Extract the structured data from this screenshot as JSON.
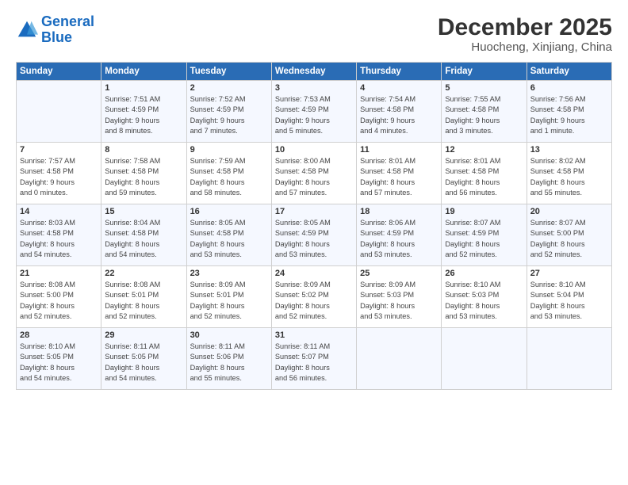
{
  "logo": {
    "line1": "General",
    "line2": "Blue"
  },
  "title": "December 2025",
  "location": "Huocheng, Xinjiang, China",
  "headers": [
    "Sunday",
    "Monday",
    "Tuesday",
    "Wednesday",
    "Thursday",
    "Friday",
    "Saturday"
  ],
  "weeks": [
    [
      {
        "day": "",
        "info": ""
      },
      {
        "day": "1",
        "info": "Sunrise: 7:51 AM\nSunset: 4:59 PM\nDaylight: 9 hours\nand 8 minutes."
      },
      {
        "day": "2",
        "info": "Sunrise: 7:52 AM\nSunset: 4:59 PM\nDaylight: 9 hours\nand 7 minutes."
      },
      {
        "day": "3",
        "info": "Sunrise: 7:53 AM\nSunset: 4:59 PM\nDaylight: 9 hours\nand 5 minutes."
      },
      {
        "day": "4",
        "info": "Sunrise: 7:54 AM\nSunset: 4:58 PM\nDaylight: 9 hours\nand 4 minutes."
      },
      {
        "day": "5",
        "info": "Sunrise: 7:55 AM\nSunset: 4:58 PM\nDaylight: 9 hours\nand 3 minutes."
      },
      {
        "day": "6",
        "info": "Sunrise: 7:56 AM\nSunset: 4:58 PM\nDaylight: 9 hours\nand 1 minute."
      }
    ],
    [
      {
        "day": "7",
        "info": "Sunrise: 7:57 AM\nSunset: 4:58 PM\nDaylight: 9 hours\nand 0 minutes."
      },
      {
        "day": "8",
        "info": "Sunrise: 7:58 AM\nSunset: 4:58 PM\nDaylight: 8 hours\nand 59 minutes."
      },
      {
        "day": "9",
        "info": "Sunrise: 7:59 AM\nSunset: 4:58 PM\nDaylight: 8 hours\nand 58 minutes."
      },
      {
        "day": "10",
        "info": "Sunrise: 8:00 AM\nSunset: 4:58 PM\nDaylight: 8 hours\nand 57 minutes."
      },
      {
        "day": "11",
        "info": "Sunrise: 8:01 AM\nSunset: 4:58 PM\nDaylight: 8 hours\nand 57 minutes."
      },
      {
        "day": "12",
        "info": "Sunrise: 8:01 AM\nSunset: 4:58 PM\nDaylight: 8 hours\nand 56 minutes."
      },
      {
        "day": "13",
        "info": "Sunrise: 8:02 AM\nSunset: 4:58 PM\nDaylight: 8 hours\nand 55 minutes."
      }
    ],
    [
      {
        "day": "14",
        "info": "Sunrise: 8:03 AM\nSunset: 4:58 PM\nDaylight: 8 hours\nand 54 minutes."
      },
      {
        "day": "15",
        "info": "Sunrise: 8:04 AM\nSunset: 4:58 PM\nDaylight: 8 hours\nand 54 minutes."
      },
      {
        "day": "16",
        "info": "Sunrise: 8:05 AM\nSunset: 4:58 PM\nDaylight: 8 hours\nand 53 minutes."
      },
      {
        "day": "17",
        "info": "Sunrise: 8:05 AM\nSunset: 4:59 PM\nDaylight: 8 hours\nand 53 minutes."
      },
      {
        "day": "18",
        "info": "Sunrise: 8:06 AM\nSunset: 4:59 PM\nDaylight: 8 hours\nand 53 minutes."
      },
      {
        "day": "19",
        "info": "Sunrise: 8:07 AM\nSunset: 4:59 PM\nDaylight: 8 hours\nand 52 minutes."
      },
      {
        "day": "20",
        "info": "Sunrise: 8:07 AM\nSunset: 5:00 PM\nDaylight: 8 hours\nand 52 minutes."
      }
    ],
    [
      {
        "day": "21",
        "info": "Sunrise: 8:08 AM\nSunset: 5:00 PM\nDaylight: 8 hours\nand 52 minutes."
      },
      {
        "day": "22",
        "info": "Sunrise: 8:08 AM\nSunset: 5:01 PM\nDaylight: 8 hours\nand 52 minutes."
      },
      {
        "day": "23",
        "info": "Sunrise: 8:09 AM\nSunset: 5:01 PM\nDaylight: 8 hours\nand 52 minutes."
      },
      {
        "day": "24",
        "info": "Sunrise: 8:09 AM\nSunset: 5:02 PM\nDaylight: 8 hours\nand 52 minutes."
      },
      {
        "day": "25",
        "info": "Sunrise: 8:09 AM\nSunset: 5:03 PM\nDaylight: 8 hours\nand 53 minutes."
      },
      {
        "day": "26",
        "info": "Sunrise: 8:10 AM\nSunset: 5:03 PM\nDaylight: 8 hours\nand 53 minutes."
      },
      {
        "day": "27",
        "info": "Sunrise: 8:10 AM\nSunset: 5:04 PM\nDaylight: 8 hours\nand 53 minutes."
      }
    ],
    [
      {
        "day": "28",
        "info": "Sunrise: 8:10 AM\nSunset: 5:05 PM\nDaylight: 8 hours\nand 54 minutes."
      },
      {
        "day": "29",
        "info": "Sunrise: 8:11 AM\nSunset: 5:05 PM\nDaylight: 8 hours\nand 54 minutes."
      },
      {
        "day": "30",
        "info": "Sunrise: 8:11 AM\nSunset: 5:06 PM\nDaylight: 8 hours\nand 55 minutes."
      },
      {
        "day": "31",
        "info": "Sunrise: 8:11 AM\nSunset: 5:07 PM\nDaylight: 8 hours\nand 56 minutes."
      },
      {
        "day": "",
        "info": ""
      },
      {
        "day": "",
        "info": ""
      },
      {
        "day": "",
        "info": ""
      }
    ]
  ]
}
